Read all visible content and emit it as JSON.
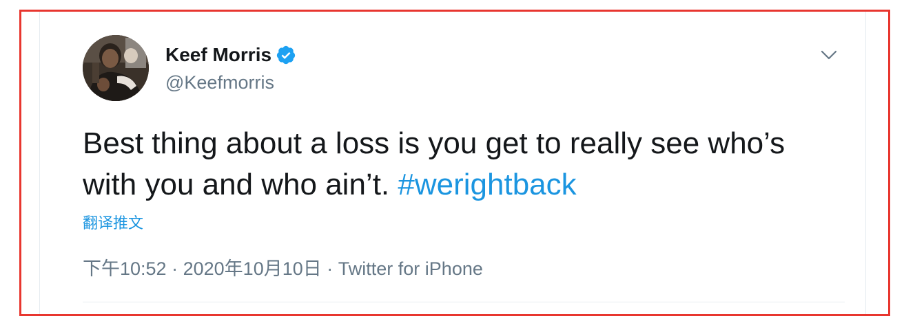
{
  "author": {
    "name": "Keef Morris",
    "handle": "@Keefmorris",
    "verified": true
  },
  "tweet": {
    "text": "Best thing about a loss is you get to really see who’s with you and who ain’t.",
    "hashtag": "#werightback",
    "translate_label": "翻译推文"
  },
  "meta": {
    "time": "下午10:52",
    "separator": "·",
    "date": "2020年10月10日",
    "source": "Twitter for iPhone"
  },
  "icons": {
    "verified": "verified-badge-icon",
    "menu": "chevron-down-icon"
  },
  "colors": {
    "frame_border": "#e8362f",
    "link": "#1b95e0",
    "text": "#14171a",
    "secondary": "#657786",
    "verified": "#1da1f2"
  }
}
